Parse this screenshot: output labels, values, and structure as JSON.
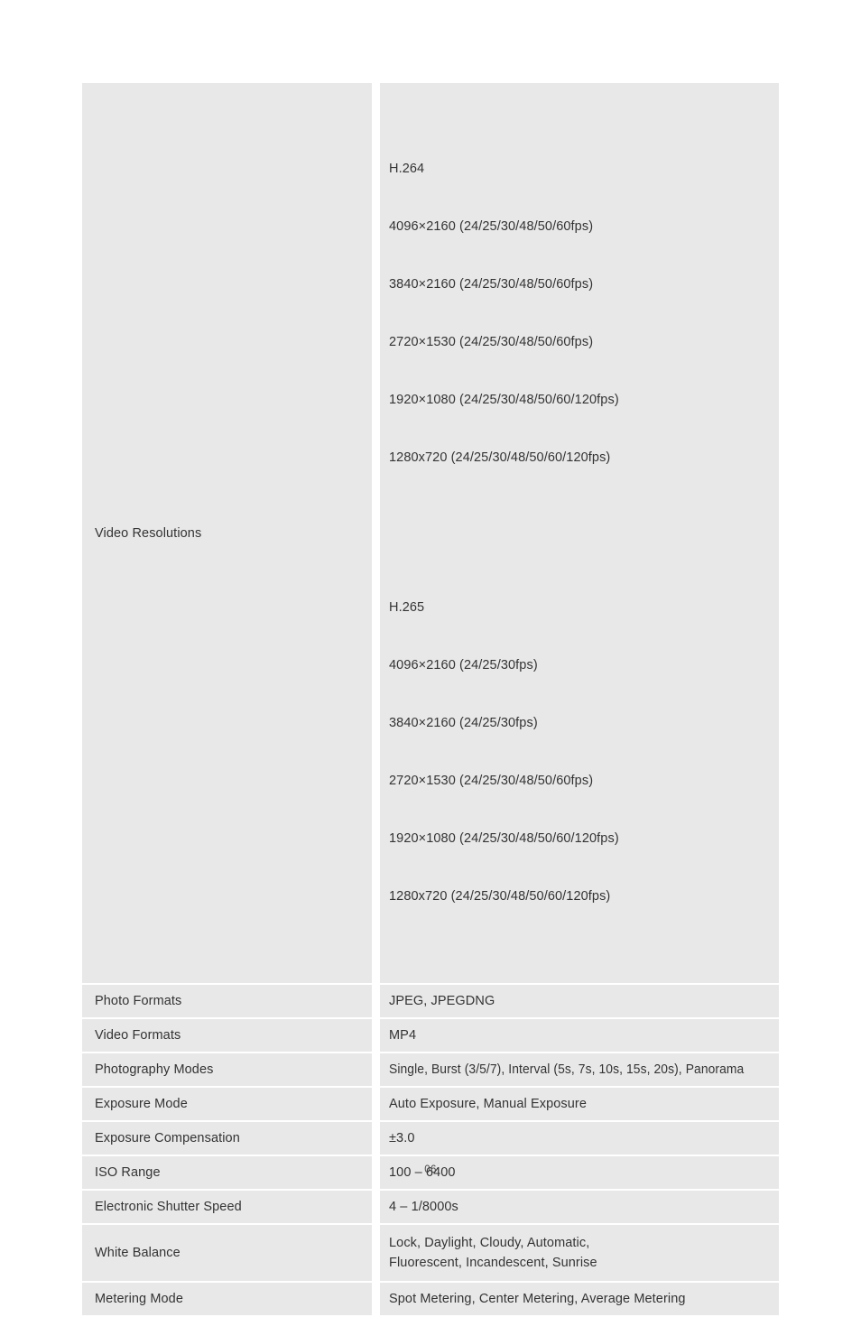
{
  "page": {
    "number": "06",
    "background_color": "#ffffff",
    "cell_color": "#e8e8e8",
    "text_color": "#333333"
  },
  "spec_table": {
    "rows": [
      {
        "label": "Video Resolutions",
        "type": "codec_groups",
        "codec_groups": [
          {
            "name": "H.264",
            "lines": [
              "4096×2160 (24/25/30/48/50/60fps)",
              "3840×2160 (24/25/30/48/50/60fps)",
              "2720×1530 (24/25/30/48/50/60fps)",
              "1920×1080 (24/25/30/48/50/60/120fps)",
              "1280x720 (24/25/30/48/50/60/120fps)"
            ]
          },
          {
            "name": "H.265",
            "lines": [
              "4096×2160 (24/25/30fps)",
              "3840×2160 (24/25/30fps)",
              "2720×1530 (24/25/30/48/50/60fps)",
              "1920×1080 (24/25/30/48/50/60/120fps)",
              "1280x720 (24/25/30/48/50/60/120fps)"
            ]
          }
        ]
      },
      {
        "label": "Photo Formats",
        "type": "single",
        "value": "JPEG, JPEGDNG"
      },
      {
        "label": "Video Formats",
        "type": "single",
        "value": "MP4"
      },
      {
        "label": "Photography Modes",
        "type": "condensed",
        "value": "Single, Burst (3/5/7), Interval (5s, 7s, 10s, 15s, 20s), Panorama"
      },
      {
        "label": "Exposure Mode",
        "type": "single",
        "value": "Auto Exposure, Manual Exposure"
      },
      {
        "label": "Exposure Compensation",
        "type": "single",
        "value": "±3.0"
      },
      {
        "label": "ISO Range",
        "type": "single",
        "value": "100 – 6400"
      },
      {
        "label": "Electronic Shutter Speed",
        "type": "single",
        "value": "4 – 1/8000s"
      },
      {
        "label": "White Balance",
        "type": "two_line",
        "value": "Lock, Daylight, Cloudy, Automatic,\nFluorescent, Incandescent, Sunrise"
      },
      {
        "label": "Metering  Mode",
        "type": "single",
        "value": "Spot Metering, Center Metering, Average Metering"
      }
    ]
  }
}
